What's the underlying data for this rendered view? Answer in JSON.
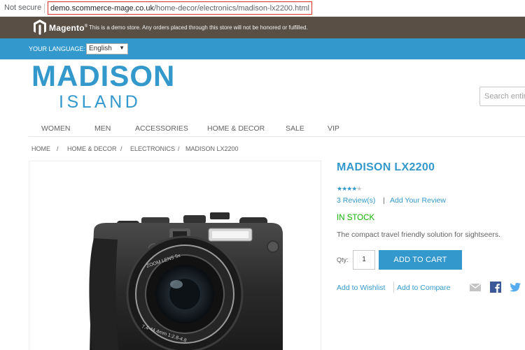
{
  "browser": {
    "security_label": "Not secure",
    "url_host": "demo.scommerce-mage.co.uk",
    "url_path": "/home-decor/electronics/madison-lx2200.html"
  },
  "demo_notice": {
    "brand": "Magento",
    "text": "This is a demo store. Any orders placed through this store will not be honored or fulfilled."
  },
  "language": {
    "label": "YOUR LANGUAGE:",
    "selected": "English"
  },
  "logo": {
    "main": "MADISON",
    "sub": "ISLAND"
  },
  "search": {
    "placeholder": "Search entire store here..."
  },
  "nav": [
    "WOMEN",
    "MEN",
    "ACCESSORIES",
    "HOME & DECOR",
    "SALE",
    "VIP"
  ],
  "breadcrumb": [
    "HOME",
    "/",
    "HOME & DECOR",
    "/",
    "ELECTRONICS",
    "/",
    "MADISON LX2200"
  ],
  "product": {
    "name": "MADISON LX2200",
    "rating_stars": 4,
    "rating_max": 5,
    "reviews": "3 Review(s)",
    "review_separator": "|",
    "add_review": "Add Your Review",
    "stock": "IN STOCK",
    "description": "The compact travel friendly solution for sightseers.",
    "qty_label": "Qty:",
    "qty_value": "1",
    "add_to_cart": "ADD TO CART",
    "add_to_wishlist": "Add to Wishlist",
    "add_to_compare": "Add to Compare",
    "camera_lens_text": "ZOOM LENS 5x",
    "camera_lens_spec": "7.4-44.4mm 1:2.8-4.8"
  },
  "icons": {
    "share": [
      "email-icon",
      "facebook-icon",
      "twitter-icon"
    ]
  },
  "colors": {
    "accent": "#3399cc",
    "notice_bar": "#5a4f45",
    "in_stock": "#11b400"
  }
}
